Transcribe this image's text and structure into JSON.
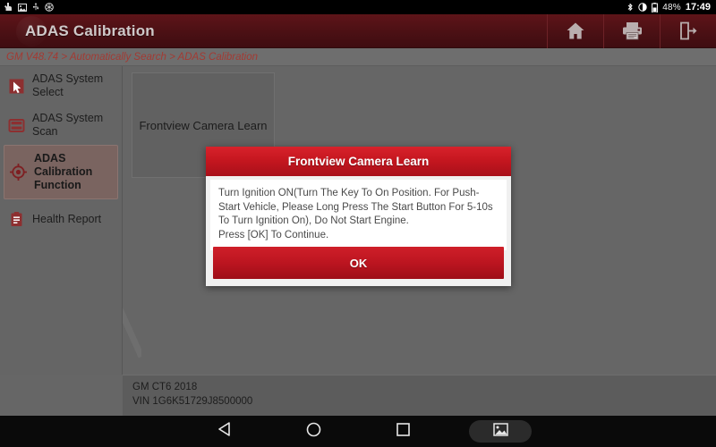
{
  "statusbar": {
    "left_icons": [
      "touch-pointer-icon",
      "screenshot-icon",
      "usb-icon",
      "settings-gear-icon"
    ],
    "right_icons": [
      "bluetooth-icon",
      "brightness-icon",
      "battery-icon"
    ],
    "battery_percent": "48%",
    "time": "17:49"
  },
  "titlebar": {
    "title": "ADAS Calibration",
    "logo": "app-logo",
    "buttons": [
      {
        "name": "home-button",
        "icon": "home-icon"
      },
      {
        "name": "print-button",
        "icon": "printer-icon"
      },
      {
        "name": "exit-button",
        "icon": "exit-icon"
      }
    ]
  },
  "breadcrumb": {
    "text": "GM V48.74 > Automatically Search > ADAS Calibration"
  },
  "sidebar": {
    "collapse_button": "collapse-sidebar-button",
    "items": [
      {
        "label": "ADAS System Select",
        "icon": "cursor-select-icon",
        "selected": false
      },
      {
        "label": "ADAS System Scan",
        "icon": "scan-list-icon",
        "selected": false
      },
      {
        "label": "ADAS Calibration Function",
        "icon": "crosshair-target-icon",
        "selected": true
      },
      {
        "label": "Health Report",
        "icon": "clipboard-report-icon",
        "selected": false
      }
    ]
  },
  "content": {
    "tiles": [
      {
        "label": "Frontview Camera Learn"
      }
    ]
  },
  "vehicle": {
    "model": "GM CT6 2018",
    "vin": "VIN 1G6K51729J8500000"
  },
  "dialog": {
    "title": "Frontview Camera Learn",
    "message_line1": "Turn Ignition ON(Turn The Key To On Position. For Push-Start Vehicle, Please Long Press The Start Button For 5-10s To Turn Ignition On), Do Not Start Engine.",
    "message_line2": "Press [OK] To Continue.",
    "ok_label": "OK"
  },
  "navbar": {
    "buttons": [
      {
        "name": "nav-back-button",
        "icon": "back-triangle-icon"
      },
      {
        "name": "nav-home-button",
        "icon": "home-circle-icon"
      },
      {
        "name": "nav-recents-button",
        "icon": "recents-square-icon"
      },
      {
        "name": "nav-screenshot-button",
        "icon": "screenshot-image-icon"
      }
    ]
  },
  "colors": {
    "brand_red": "#a8101a",
    "dialog_red": "#c4161f",
    "titlebar_maroon": "#4b1014",
    "workspace_gray": "#666666",
    "breadcrumb_red": "#a33a33"
  }
}
